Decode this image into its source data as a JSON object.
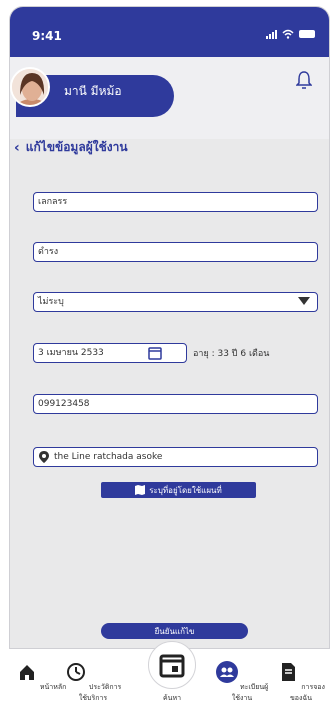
{
  "status": {
    "time": "9:41"
  },
  "user": {
    "name": "มานี มีหม้อ"
  },
  "page": {
    "title": "แก้ไขข้อมูลผู้ใช้งาน"
  },
  "form": {
    "firstname": "เลกลรร",
    "lastname": "ดำรง",
    "gender": "ไม่ระบุ",
    "birthdate": "3 เมษายน 2533",
    "age": "อายุ : 33 ปี 6 เดือน",
    "phone": "099123458",
    "address": "the Line ratchada asoke",
    "map_button": "ระบุที่อยู่โดยใช้แผนที่",
    "confirm_button": "ยืนยันแก้ไข"
  },
  "nav": {
    "home": "หน้าหลัก",
    "history": "ประวัติการใช้บริการ",
    "search": "ค้นหา",
    "registry": "ทะเบียนผู้ใช้งาน",
    "orders": "การจองของฉัน"
  },
  "colors": {
    "accent": "#2f3a9c",
    "background": "#e9e9ea"
  }
}
